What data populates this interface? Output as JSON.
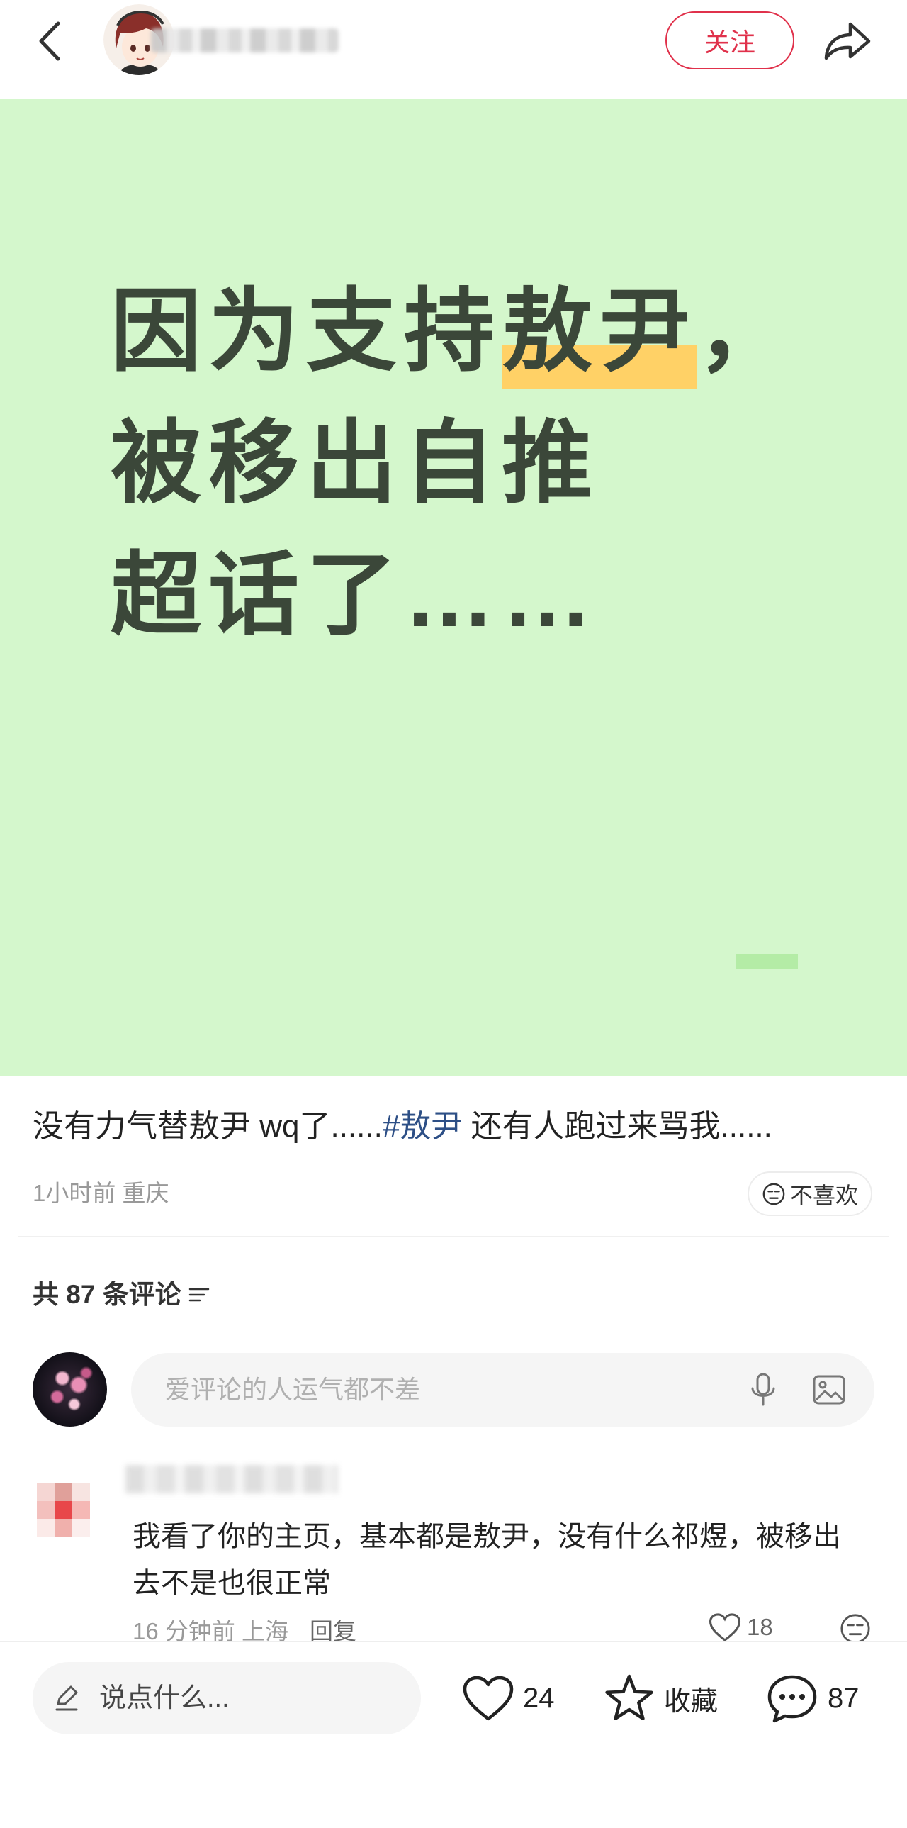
{
  "colors": {
    "accent": "#e0314b",
    "hashtag": "#2d4f86",
    "image_bg": "#d4f7cc",
    "highlight": "#ffd166",
    "headline_text": "#3b4739",
    "mark": "#b4eca6"
  },
  "icons": [
    "back-arrow-icon",
    "share-icon",
    "filter-icon",
    "dislike-face-icon",
    "microphone-icon",
    "image-icon",
    "heart-icon",
    "star-icon",
    "chat-bubble-icon",
    "pencil-icon"
  ],
  "header": {
    "follow_label": "关注"
  },
  "post_image": {
    "headline": {
      "line1_a": "因为支持",
      "line1_highlight": "敖尹",
      "line1_b": "，",
      "line2": "被移出自推",
      "line3": "超话了……"
    }
  },
  "post": {
    "caption_before": "没有力气替敖尹 wq了......",
    "caption_tag": "#敖尹",
    "caption_after": " 还有人跑过来骂我......",
    "time": "1小时前",
    "location": "重庆",
    "dislike_label": "不喜欢"
  },
  "comments_section": {
    "count_label": "共 87 条评论",
    "input_placeholder": "爱评论的人运气都不差",
    "comments": [
      {
        "text": "我看了你的主页，基本都是敖尹，没有什么祁煜，被移出去不是也很正常",
        "time": "16 分钟前",
        "location": "上海",
        "reply_label": "回复",
        "likes": "18"
      }
    ]
  },
  "bottom_bar": {
    "input_placeholder": "说点什么...",
    "likes": "24",
    "favorite_label": "收藏",
    "comments": "87"
  }
}
